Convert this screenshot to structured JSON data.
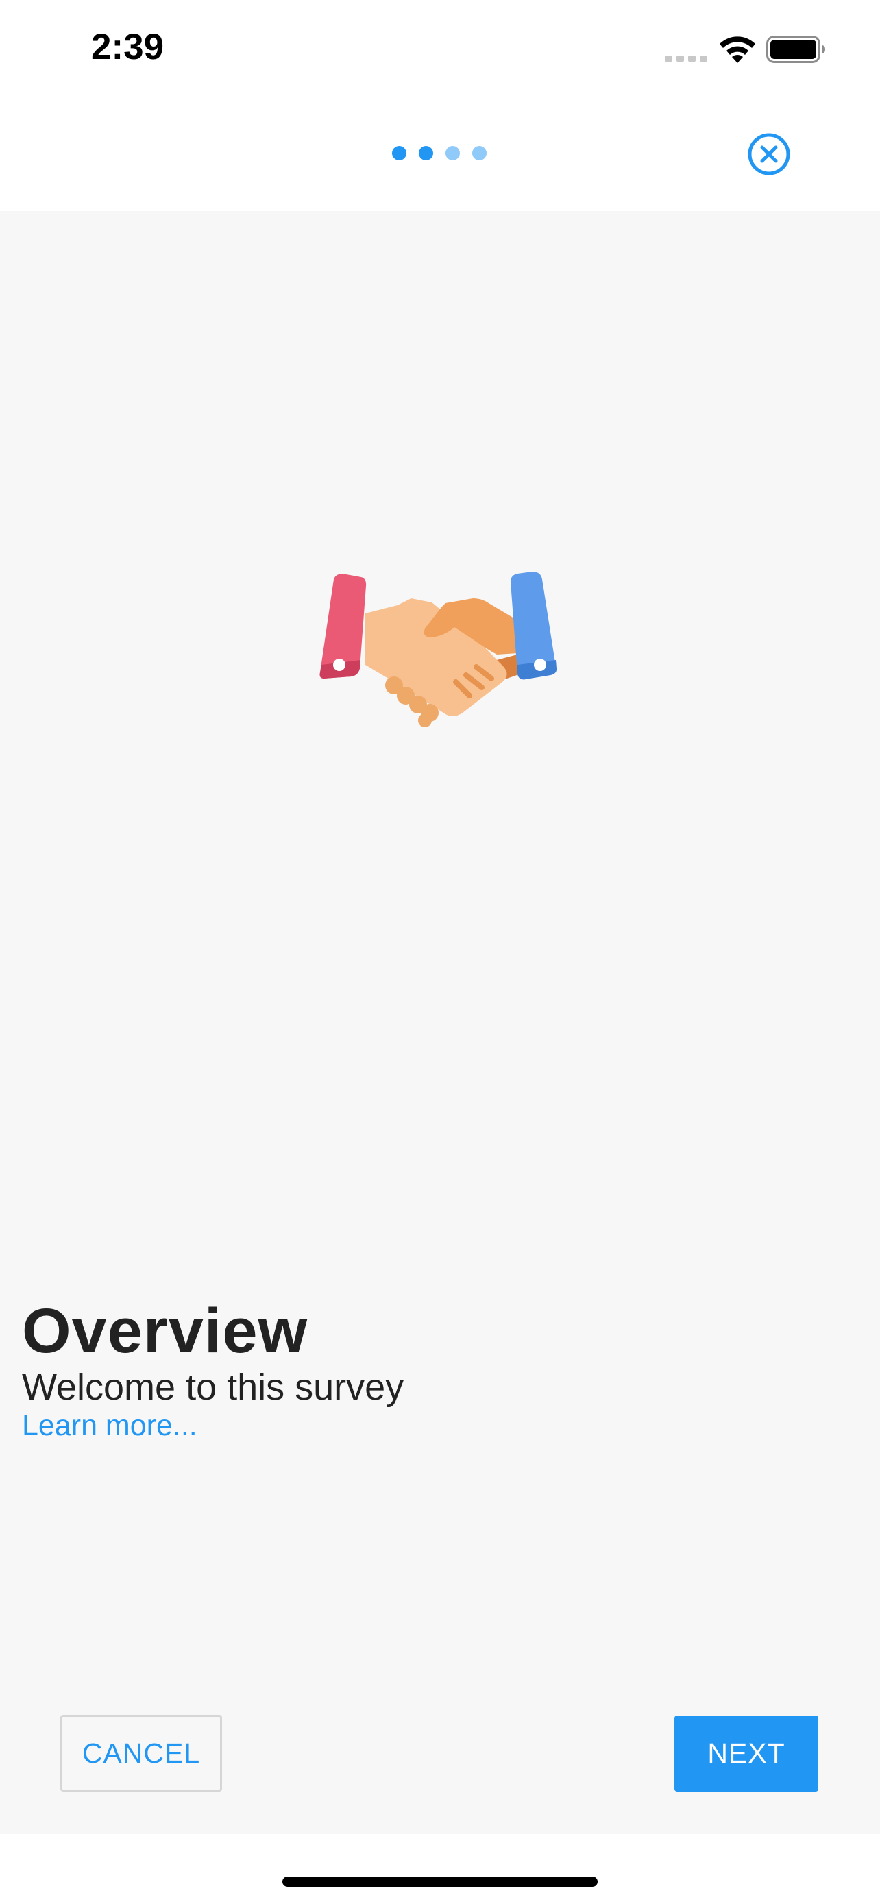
{
  "status_bar": {
    "time": "2:39",
    "icons": [
      "signal-icon",
      "wifi-icon",
      "battery-icon"
    ]
  },
  "pager": {
    "total_pages": 4,
    "active_color": "#2196f3",
    "inactive_color": "#90caf9"
  },
  "header": {
    "close_icon": "close-circle-icon"
  },
  "illustration": {
    "icon": "handshake-icon"
  },
  "content": {
    "title": "Overview",
    "subtitle": "Welcome to this survey",
    "link_label": "Learn more..."
  },
  "actions": {
    "cancel_label": "CANCEL",
    "next_label": "NEXT"
  },
  "colors": {
    "accent": "#2196f3",
    "background": "#f7f7f7",
    "surface": "#ffffff",
    "text": "#222222"
  }
}
